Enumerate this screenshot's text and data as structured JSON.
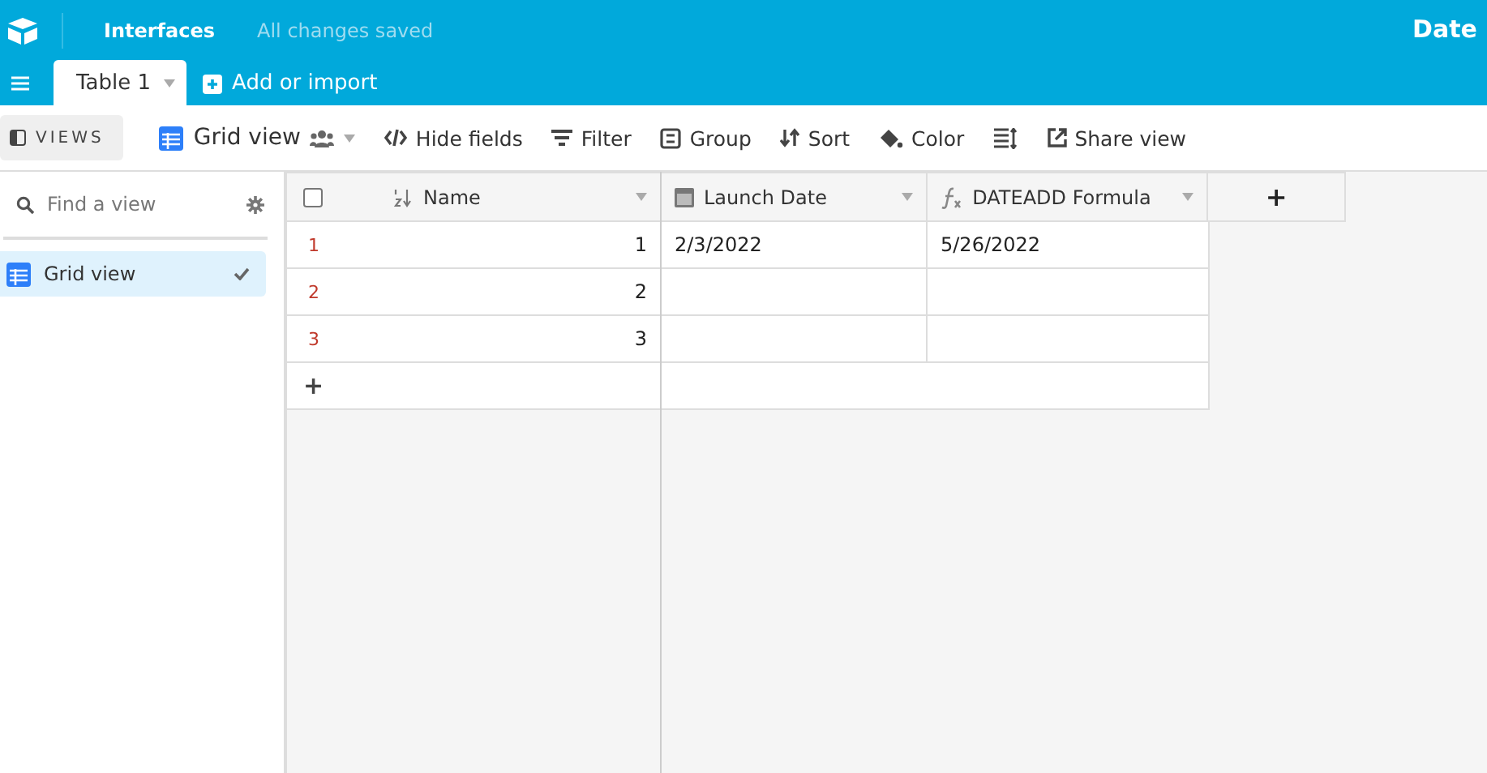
{
  "topbar": {
    "nav": "Interfaces",
    "status": "All changes saved",
    "base_title": "Date"
  },
  "tabs": [
    {
      "label": "Table 1",
      "selected": true
    }
  ],
  "add_table": "Add or import",
  "toolbar": {
    "views_toggle": "VIEWS",
    "view_name": "Grid view",
    "items": [
      {
        "kind": "hide",
        "label": "Hide fields"
      },
      {
        "kind": "filter",
        "label": "Filter"
      },
      {
        "kind": "group",
        "label": "Group"
      },
      {
        "kind": "sort",
        "label": "Sort"
      },
      {
        "kind": "color",
        "label": "Color"
      },
      {
        "kind": "height"
      },
      {
        "kind": "share",
        "label": "Share view"
      }
    ]
  },
  "sidebar": {
    "search": {
      "placeholder": "Find a view"
    },
    "items": [
      {
        "label": "Grid view",
        "selected": true
      }
    ]
  },
  "table": {
    "select_all": {
      "checked": false
    },
    "columns": [
      {
        "kind": "number",
        "label": "Name"
      },
      {
        "kind": "date",
        "label": "Launch Date"
      },
      {
        "kind": "formula",
        "label": "DATEADD Formula"
      }
    ],
    "rows": [
      {
        "number": "1",
        "cells": [
          "1",
          "2/3/2022",
          "5/26/2022"
        ]
      },
      {
        "number": "2",
        "cells": [
          "2",
          "",
          ""
        ]
      },
      {
        "number": "3",
        "cells": [
          "3",
          "",
          ""
        ]
      }
    ],
    "add_row": "+",
    "add_column": "+"
  }
}
